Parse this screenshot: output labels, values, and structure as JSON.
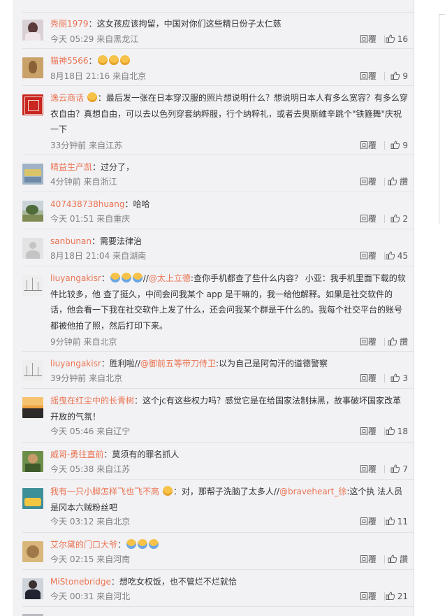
{
  "reply_label": "回覆",
  "comments": [
    {
      "user": "秀丽1979",
      "sep": "：",
      "content": "这女孩应该拘留，中国对你们这些精日份子太仁慈",
      "time": "今天 05:29 来自黑龙江",
      "likes": "16"
    },
    {
      "user": "猫神5566",
      "sep": "：",
      "emojis": 3,
      "time": "8月18日 21:16 来自北京",
      "likes": "9"
    },
    {
      "user": "逸云商话",
      "sep": "：",
      "content": "最后发一张在日本穿汉服的照片想说明什么？想说明日本人有多么宽容？有多么穿衣自由？真想自由，可以去以色列穿套纳粹服，行个纳粹礼，或者去奥斯維辛跳个\"铁箍舞\"庆祝一下",
      "time": "33分钟前 来自江苏",
      "likes": "9"
    },
    {
      "user": "精益生产凯",
      "sep": "：",
      "content": "过分了，",
      "time": "4分钟前 来自浙江",
      "likes": "讚"
    },
    {
      "user": "407438738huang",
      "sep": "：",
      "content": "哈哈",
      "time": "今天 01:51 来自重庆",
      "likes": "2"
    },
    {
      "user": "sanbunan",
      "sep": "：",
      "content": "需要法律治",
      "time": "8月18日 21:04 来自湖南",
      "likes": "45"
    },
    {
      "user": "liuyangakisr",
      "sep": "：",
      "mention": "@太上立德",
      "content_pre": "//",
      "content": ":查你手机都查了些什么内容？ 小亚：我手机里面下载的软件比较多，他 查了挺久，中间会问我某个 app 是干嘛的，我一给他解释。如果是社交软件的话，他会看一下我在社交软件上发了什么，还会问我某个群是干什么的。我每个社交平台的账号都被他拍了照，然后打印下来。",
      "time": "9分钟前 来自北京",
      "likes": "讚"
    },
    {
      "user": "liuyangakisr",
      "sep": "：",
      "content_pre": "胜利啦//",
      "mention": "@御前五等带刀侍卫",
      "content": ":以为自己是阿訇汗的道德警察",
      "time": "39分钟前 来自北京",
      "likes": "3"
    },
    {
      "user": "摇曳在红尘中的长青树",
      "sep": "：",
      "content": "这个jc有这些权力吗？感觉它是在给国家法制抹黑，故事破坏国家改革开放的气氛！",
      "time": "今天 05:46 来自辽宁",
      "likes": "18"
    },
    {
      "user": "威哥-勇往直前",
      "sep": "：",
      "content": "莫须有的罪名抓人",
      "time": "今天 05:38 来自江苏",
      "likes": "7"
    },
    {
      "user": "我有一只小脚怎样飞也飞不高",
      "sep": "：",
      "content": "对，那帮子洗脑了太多人//",
      "mention": "@braveheart_徐",
      "content_post": ":这个执 法人员是冈本六贼粉丝吧",
      "time": "今天 03:12 来自北京",
      "likes": "11"
    },
    {
      "user": "艾尔黛的门口大爷",
      "sep": "：",
      "emojis": 3,
      "time": "今天 02:15 来自河南",
      "likes": "讚"
    },
    {
      "user": "MiStonebridge",
      "sep": "：",
      "content": "想吃女权饭，也不管烂不烂就恰",
      "time": "今天 00:31 来自河北",
      "likes": "21"
    }
  ]
}
